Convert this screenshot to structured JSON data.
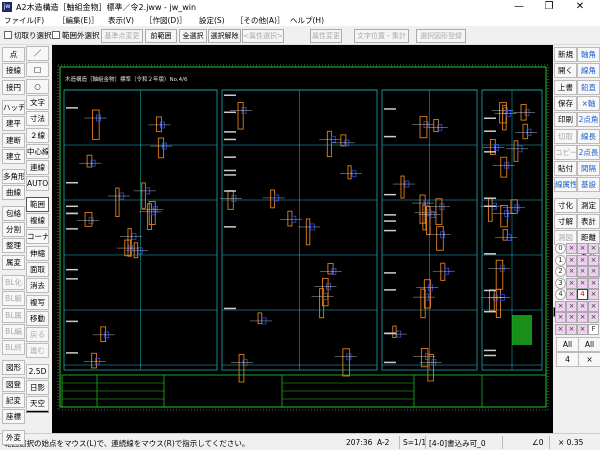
{
  "window": {
    "title": "A2木造構造［軸組金物］標準／令2.jww - jw_win",
    "icon": "jw",
    "minimize": "—",
    "maximize": "❐",
    "close": "✕"
  },
  "menu": [
    "ファイル(F)",
    "［編集(E)］",
    "表示(V)",
    "［作図(D)］",
    "設定(S)",
    "［その他(A)］",
    "ヘルプ(H)"
  ],
  "toolbar": {
    "cut_select": "切取り選択",
    "out_of_range": "範囲外選択",
    "buttons": [
      {
        "label": "基準点変更",
        "disabled": true
      },
      {
        "label": "前範囲",
        "disabled": false
      },
      {
        "label": "全選択",
        "disabled": false
      },
      {
        "label": "選択解除",
        "disabled": false
      },
      {
        "label": "<属性選択>",
        "disabled": true
      },
      {
        "label": "属性変更",
        "disabled": true
      },
      {
        "label": "文字位置・集計",
        "disabled": true
      },
      {
        "label": "選択図形登録",
        "disabled": true
      }
    ]
  },
  "left_col1": [
    {
      "label": "点"
    },
    {
      "label": "接線"
    },
    {
      "label": "接円"
    },
    {
      "label": "ハッチ"
    },
    {
      "label": "建平"
    },
    {
      "label": "建断"
    },
    {
      "label": "建立"
    },
    {
      "label": "多角形"
    },
    {
      "label": "曲線"
    },
    {
      "label": "包絡"
    },
    {
      "label": "分割"
    },
    {
      "label": "整理"
    },
    {
      "label": "属変"
    },
    {
      "label": "BL化",
      "disabled": true
    },
    {
      "label": "BL解",
      "disabled": true
    },
    {
      "label": "BL属",
      "disabled": true
    },
    {
      "label": "BL編",
      "disabled": true
    },
    {
      "label": "BL終",
      "disabled": true
    },
    {
      "label": "図形"
    },
    {
      "label": "図登"
    },
    {
      "label": "記変"
    },
    {
      "label": "座標"
    },
    {
      "label": "外変"
    }
  ],
  "left_col2": [
    {
      "label": "／"
    },
    {
      "label": "□"
    },
    {
      "label": "○"
    },
    {
      "label": "文字"
    },
    {
      "label": "寸法"
    },
    {
      "label": "２線"
    },
    {
      "label": "中心線"
    },
    {
      "label": "連線"
    },
    {
      "label": "AUTO"
    },
    {
      "label": "範囲",
      "selected": true
    },
    {
      "label": "複線"
    },
    {
      "label": "コーナー"
    },
    {
      "label": "伸縮"
    },
    {
      "label": "面取"
    },
    {
      "label": "消去"
    },
    {
      "label": "複写"
    },
    {
      "label": "移動"
    },
    {
      "label": "戻る",
      "disabled": true
    },
    {
      "label": "進む",
      "disabled": true
    },
    {
      "label": "2.5D"
    },
    {
      "label": "日影"
    },
    {
      "label": "天空"
    }
  ],
  "right_col1": [
    {
      "label": "新規"
    },
    {
      "label": "開く"
    },
    {
      "label": "上書"
    },
    {
      "label": "保存"
    },
    {
      "label": "印刷"
    },
    {
      "label": "切取",
      "disabled": true
    },
    {
      "label": "コピー",
      "disabled": true
    },
    {
      "label": "貼付"
    },
    {
      "label": "線属性",
      "blue": true
    },
    {
      "label": "寸化"
    },
    {
      "label": "寸解"
    },
    {
      "label": "測図",
      "disabled": true
    }
  ],
  "right_col2": [
    {
      "label": "軸角",
      "blue": true
    },
    {
      "label": "線角",
      "blue": true
    },
    {
      "label": "鉛直",
      "blue": true
    },
    {
      "label": "×軸",
      "blue": true
    },
    {
      "label": "2点角",
      "blue": true
    },
    {
      "label": "線長",
      "blue": true
    },
    {
      "label": "2点長",
      "blue": true
    },
    {
      "label": "間隔",
      "blue": true
    },
    {
      "label": "基設",
      "blue": true
    },
    {
      "label": "測定"
    },
    {
      "label": "表計"
    },
    {
      "label": "距離"
    },
    {
      "label": "式計"
    },
    {
      "label": "パラメ"
    }
  ],
  "layers": {
    "groups": [
      "0",
      "1",
      "2",
      "3",
      "4"
    ],
    "layer_active": "4",
    "layer_extra": "F",
    "all_label": "All",
    "current_group": "4"
  },
  "drawing": {
    "title": "木造構造［軸組金物］標準（令和２年版）No.4/6",
    "colors": {
      "frame": "#22cc22",
      "panel": "#22bbcc",
      "part": "#e08020",
      "part2": "#3050e0",
      "text": "#e0e0e0"
    }
  },
  "status": {
    "message": "範囲選択の始点をマウス(L)で、連続線をマウス(R)で指示してください。",
    "scale_info": "207:36",
    "paper": "A-2",
    "scale": "S=1/1",
    "layer": "[4-0]書込み可_0",
    "angle": "∠0",
    "zoom": "× 0.35"
  }
}
